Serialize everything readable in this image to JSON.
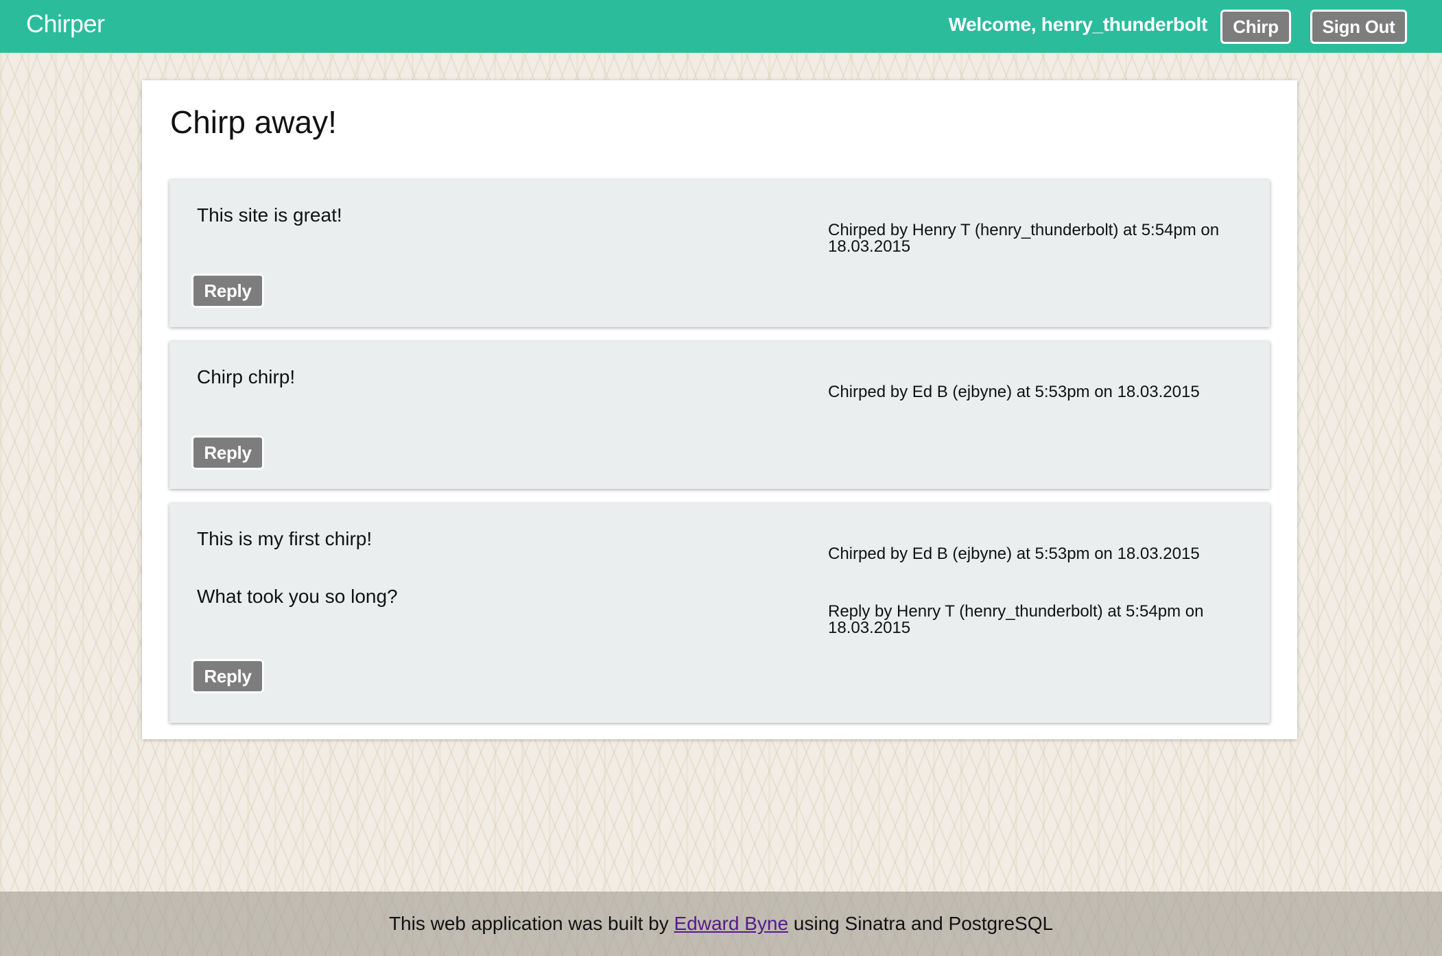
{
  "navbar": {
    "brand": "Chirper",
    "welcome": "Welcome, henry_thunderbolt",
    "chirp_button": "Chirp",
    "signout_button": "Sign Out"
  },
  "main": {
    "title": "Chirp away!"
  },
  "chirps": [
    {
      "text": "This site is great!",
      "meta": "Chirped by Henry T (henry_thunderbolt) at 5:54pm on 18.03.2015",
      "reply_button": "Reply"
    },
    {
      "text": "Chirp chirp!",
      "meta": "Chirped by Ed B (ejbyne) at 5:53pm on 18.03.2015",
      "reply_button": "Reply"
    },
    {
      "text": "This is my first chirp!",
      "meta": "Chirped by Ed B (ejbyne) at 5:53pm on 18.03.2015",
      "reply": {
        "text": "What took you so long?",
        "meta": "Reply by Henry T (henry_thunderbolt) at 5:54pm on 18.03.2015"
      },
      "reply_button": "Reply"
    }
  ],
  "footer": {
    "prefix": "This web application was built by ",
    "author_link": "Edward Byne",
    "suffix": " using Sinatra and PostgreSQL"
  },
  "colors": {
    "navbar": "#2bbc9c",
    "button": "#7d7d7d",
    "card": "#ebeeee",
    "link": "#551a8b"
  }
}
